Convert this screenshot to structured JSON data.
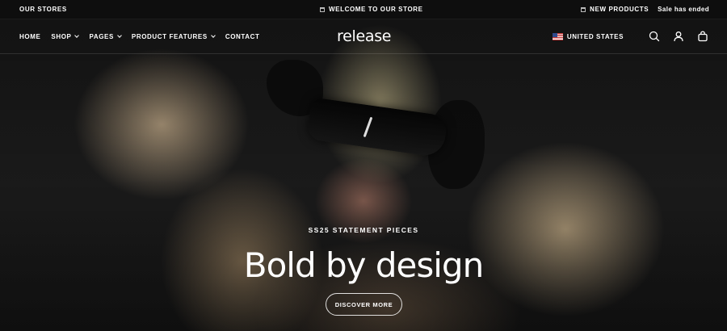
{
  "announcement": {
    "left": "OUR STORES",
    "center": "WELCOME TO OUR STORE",
    "right_new": "NEW PRODUCTS",
    "right_sale": "Sale has ended"
  },
  "header": {
    "nav": [
      {
        "label": "HOME",
        "has_dropdown": false
      },
      {
        "label": "SHOP",
        "has_dropdown": true
      },
      {
        "label": "PAGES",
        "has_dropdown": true
      },
      {
        "label": "PRODUCT FEATURES",
        "has_dropdown": true
      },
      {
        "label": "CONTACT",
        "has_dropdown": false
      }
    ],
    "logo": "release",
    "country": "UNITED STATES",
    "icons": [
      "search-icon",
      "account-icon",
      "cart-icon"
    ]
  },
  "hero": {
    "eyebrow": "SS25 STATEMENT PIECES",
    "headline": "Bold by design",
    "cta": "DISCOVER MORE"
  },
  "colors": {
    "background": "#0d0d0d",
    "text": "#ffffff"
  }
}
